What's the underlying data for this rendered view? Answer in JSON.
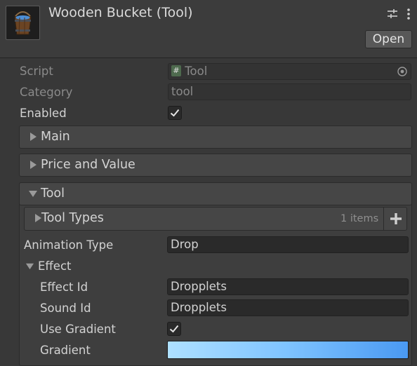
{
  "header": {
    "title": "Wooden Bucket (Tool)",
    "open_label": "Open",
    "icons": [
      "bucket-thumbnail-icon",
      "sliders-icon",
      "kebab-menu-icon"
    ]
  },
  "script_row": {
    "label": "Script",
    "value": "Tool",
    "icon": "script-hash-icon"
  },
  "category_row": {
    "label": "Category",
    "value": "tool"
  },
  "enabled_row": {
    "label": "Enabled",
    "checked": true
  },
  "foldouts": {
    "main": "Main",
    "price": "Price and Value",
    "tool": "Tool"
  },
  "tool_types": {
    "label": "Tool Types",
    "count_text": "1 items"
  },
  "animation_type": {
    "label": "Animation Type",
    "value": "Drop"
  },
  "effect": {
    "label": "Effect",
    "effect_id_label": "Effect Id",
    "effect_id_value": "Dropplets",
    "sound_id_label": "Sound Id",
    "sound_id_value": "Dropplets",
    "use_gradient_label": "Use Gradient",
    "use_gradient_checked": true,
    "gradient_label": "Gradient",
    "gradient_colors": [
      "#aee0ff",
      "#7ec3ff",
      "#4a99f2"
    ]
  }
}
